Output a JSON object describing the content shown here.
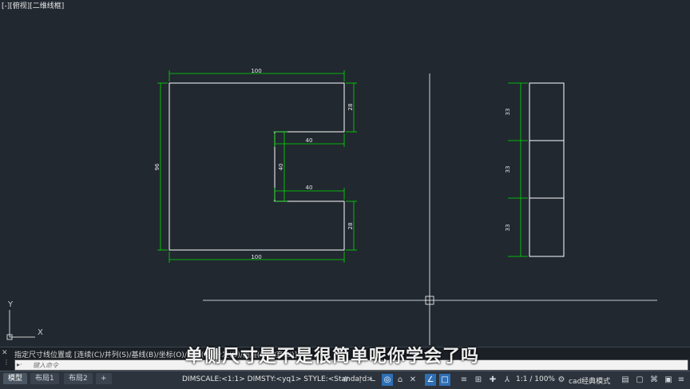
{
  "viewport": {
    "label": "[-][俯视][二维线框]"
  },
  "dimensions_left": {
    "top_width": "100",
    "bottom_width": "100",
    "left_height": "96",
    "upper_right": "28",
    "lower_right": "28",
    "slot_top": "40",
    "slot_bottom": "40",
    "slot_depth": "40"
  },
  "dimensions_right": {
    "seg1": "33",
    "seg2": "33",
    "seg3": "33"
  },
  "ucs": {
    "x_label": "X",
    "y_label": "Y"
  },
  "command": {
    "history": "指定尺寸线位置或 [连续(C)/并列(S)/基线(B)/坐标(O)/对齐(G)/分发(D)/图层(L)/放弃(U)]:",
    "input_placeholder": "键入命令",
    "close_glyph": "✕"
  },
  "subtitle": "单侧尺寸是不是很简单呢你学会了吗",
  "tabs": [
    "模型",
    "布局1",
    "布局2"
  ],
  "add_tab": "+",
  "status": {
    "dim_info": "DIMSCALE:<1:1> DIMSTY:<yq1> STYLE:<Standard>",
    "scale": "1:1 / 100%",
    "workspace": "cad经典模式"
  },
  "colors": {
    "background": "#212830",
    "geometry": "#ffffff",
    "dimension": "#00e000",
    "text": "#e6e6e6"
  }
}
